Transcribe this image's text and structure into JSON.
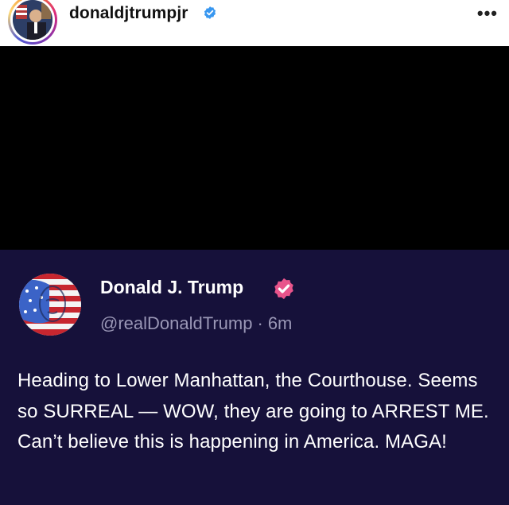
{
  "instagram": {
    "username": "donaldjtrumpjr",
    "more_label": "•••",
    "verified_color": "#3897f0"
  },
  "post": {
    "display_name": "Donald J. Trump",
    "handle": "@realDonaldTrump",
    "separator": "·",
    "time": "6m",
    "text": "Heading to Lower Manhattan, the Courthouse. Seems so SURREAL — WOW, they are going to ARREST ME. Can’t believe this is happening in America. MAGA!",
    "verified_color": "#e8548b",
    "background_color": "#16113a"
  }
}
